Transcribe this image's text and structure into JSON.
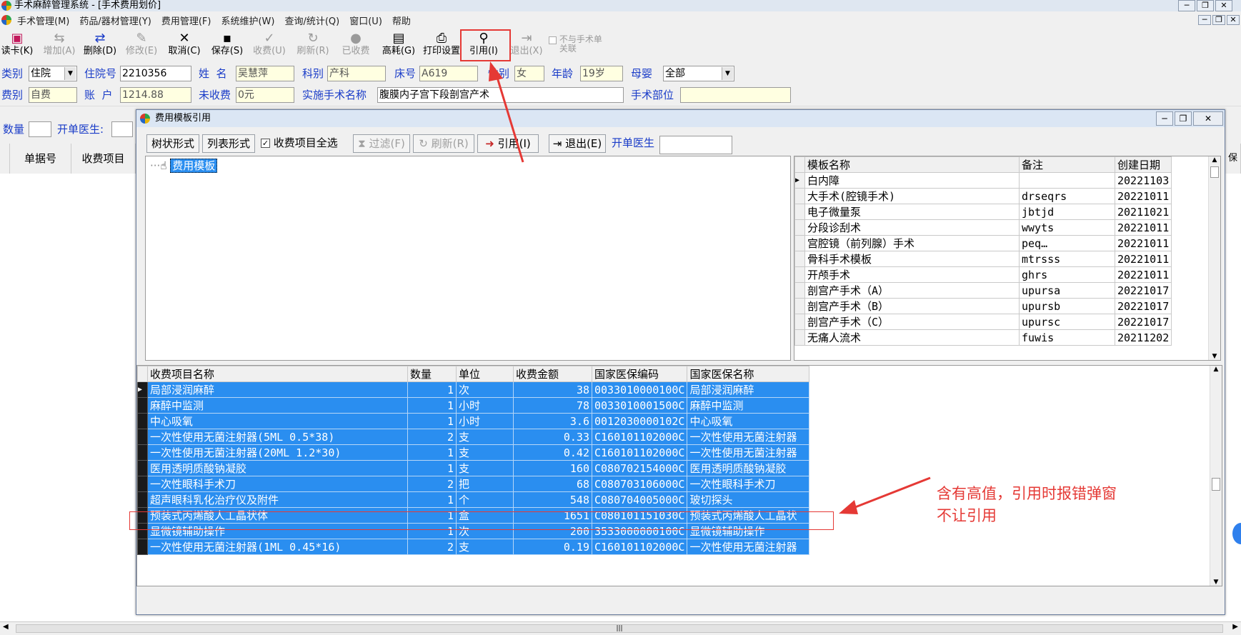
{
  "window": {
    "title": "手术麻醉管理系统 - [手术费用划价]"
  },
  "menu": [
    "手术管理(M)",
    "药品/器材管理(Y)",
    "费用管理(F)",
    "系统维护(W)",
    "查询/统计(Q)",
    "窗口(U)",
    "帮助"
  ],
  "toolbar": {
    "read_card": "读卡(K)",
    "add": "增加(A)",
    "delete": "删除(D)",
    "modify": "修改(E)",
    "cancel": "取消(C)",
    "save": "保存(S)",
    "collect": "收费(U)",
    "refresh": "刷新(R)",
    "collected": "已收费",
    "high_value": "高耗(G)",
    "print_setup": "打印设置",
    "quote": "引用(I)",
    "exit": "退出(X)",
    "unlink_line1": "不与手术单",
    "unlink_line2": "关联"
  },
  "form": {
    "category_label": "类别",
    "category": "住院",
    "inpatient_no_label": "住院号",
    "inpatient_no": "2210356",
    "name_label": "姓  名",
    "name": "吴慧萍",
    "dept_label": "科别",
    "dept": "产科",
    "bed_label": "床号",
    "bed": "A619",
    "sex_label": "性别",
    "sex": "女",
    "age_label": "年龄",
    "age": "19岁",
    "infant_label": "母婴",
    "infant": "全部",
    "fee_type_label": "费别",
    "fee_type": "自费",
    "account_label": "账  户",
    "account": "1214.88",
    "unpaid_label": "未收费",
    "unpaid": "0元",
    "surgery_label": "实施手术名称",
    "surgery": "腹膜内子宫下段剖宫产术",
    "site_label": "手术部位",
    "site": "",
    "qty_label": "数量",
    "doctor_label": "开单医生:"
  },
  "main_headers": {
    "receipt_no": "单据号",
    "fee_item": "收费项目",
    "right_partial": "保编"
  },
  "dialog": {
    "title": "费用模板引用",
    "tab_tree": "树状形式",
    "tab_list": "列表形式",
    "select_all_label": "收费项目全选",
    "filter": "过滤(F)",
    "refresh": "刷新(R)",
    "quote": "引用(I)",
    "exit": "退出(E)",
    "doctor_label": "开单医生",
    "tree_root": "费用模板",
    "template_headers": [
      "模板名称",
      "备注",
      "创建日期"
    ],
    "templates": [
      {
        "name": "白内障",
        "note": "",
        "date": "20221103"
      },
      {
        "name": "大手术(腔镜手术)",
        "note": "drseqrs",
        "date": "20221011"
      },
      {
        "name": "电子微量泵",
        "note": "jbtjd",
        "date": "20211021"
      },
      {
        "name": "分段诊刮术",
        "note": "wwyts",
        "date": "20221011"
      },
      {
        "name": "宫腔镜（前列腺）手术",
        "note": "peq… ",
        "date": "20221011"
      },
      {
        "name": "骨科手术模板",
        "note": "mtrsss",
        "date": "20221011"
      },
      {
        "name": "开颅手术",
        "note": "ghrs",
        "date": "20221011"
      },
      {
        "name": "剖宫产手术（A）",
        "note": "upursa",
        "date": "20221017"
      },
      {
        "name": "剖宫产手术（B）",
        "note": "upursb",
        "date": "20221017"
      },
      {
        "name": "剖宫产手术（C）",
        "note": "upursc",
        "date": "20221017"
      },
      {
        "name": "无痛人流术",
        "note": "fuwis",
        "date": "20211202"
      }
    ],
    "fee_headers": [
      "收费项目名称",
      "数量",
      "单位",
      "收费金额",
      "国家医保编码",
      "国家医保名称"
    ],
    "fees": [
      {
        "name": "局部浸润麻醉",
        "qty": "1",
        "unit": "次",
        "amount": "38",
        "code": "0033010000100C",
        "ins": "局部浸润麻醉"
      },
      {
        "name": "麻醉中监测",
        "qty": "1",
        "unit": "小时",
        "amount": "78",
        "code": "0033010001500C",
        "ins": "麻醉中监测"
      },
      {
        "name": "中心吸氧",
        "qty": "1",
        "unit": "小时",
        "amount": "3.6",
        "code": "0012030000102C",
        "ins": "中心吸氧"
      },
      {
        "name": "一次性使用无菌注射器(5ML 0.5*38)",
        "qty": "2",
        "unit": "支",
        "amount": "0.33",
        "code": "C160101102000C",
        "ins": "一次性使用无菌注射器"
      },
      {
        "name": "一次性使用无菌注射器(20ML 1.2*30)",
        "qty": "1",
        "unit": "支",
        "amount": "0.42",
        "code": "C160101102000C",
        "ins": "一次性使用无菌注射器"
      },
      {
        "name": "医用透明质酸钠凝胶",
        "qty": "1",
        "unit": "支",
        "amount": "160",
        "code": "C080702154000C",
        "ins": "医用透明质酸钠凝胶"
      },
      {
        "name": "一次性眼科手术刀",
        "qty": "2",
        "unit": "把",
        "amount": "68",
        "code": "C080703106000C",
        "ins": "一次性眼科手术刀"
      },
      {
        "name": "超声眼科乳化治疗仪及附件",
        "qty": "1",
        "unit": "个",
        "amount": "548",
        "code": "C080704005000C",
        "ins": "玻切探头"
      },
      {
        "name": "预装式丙烯酸人工晶状体",
        "qty": "1",
        "unit": "盒",
        "amount": "1651",
        "code": "C080101151030C",
        "ins": "预装式丙烯酸人工晶状"
      },
      {
        "name": "显微镜辅助操作",
        "qty": "1",
        "unit": "次",
        "amount": "200",
        "code": "3533000000100C",
        "ins": "显微镜辅助操作"
      },
      {
        "name": "一次性使用无菌注射器(1ML 0.45*16)",
        "qty": "2",
        "unit": "支",
        "amount": "0.19",
        "code": "C160101102000C",
        "ins": "一次性使用无菌注射器"
      }
    ]
  },
  "annotation": {
    "line1": "含有高值，引用时报错弹窗",
    "line2": "不让引用"
  },
  "colors": {
    "selection": "#2a8ef0",
    "annotation": "#e53935",
    "label": "#1a3cc8",
    "readonly_field": "#ffffe1"
  }
}
